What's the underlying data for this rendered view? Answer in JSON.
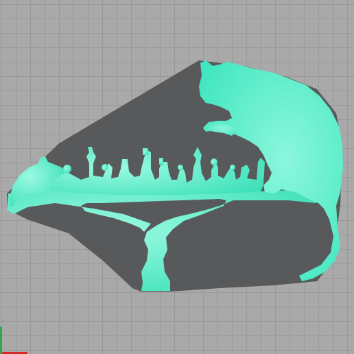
{
  "colors": {
    "grid_background": "#a9a9a9",
    "grid_line": "#999999",
    "plate": "#58595b",
    "silhouette_light": "#8cf7dc",
    "silhouette_dark": "#3fe6bf",
    "axis_x": "#d42a2a",
    "axis_y": "#2fa84f"
  },
  "icons": [
    "cat-silhouette",
    "mouse-silhouette",
    "chess-pieces-silhouette",
    "chessboard-table-silhouette"
  ]
}
